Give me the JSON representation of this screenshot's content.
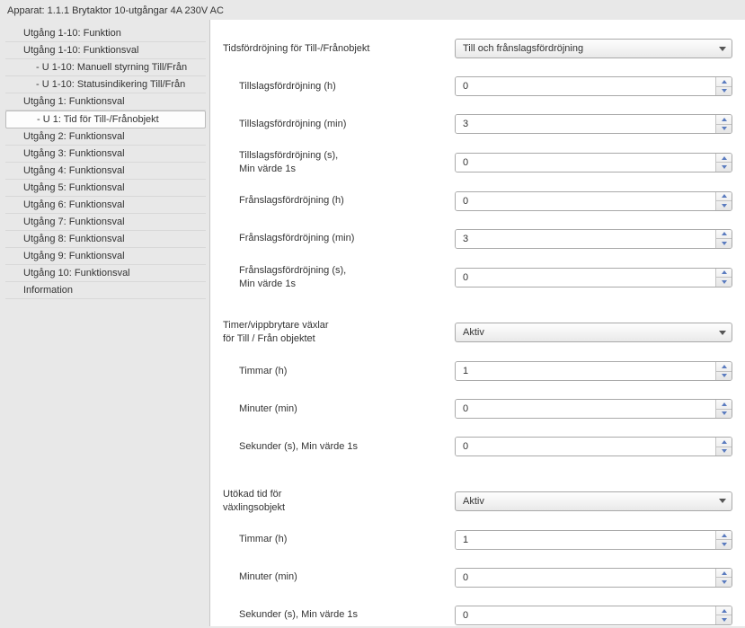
{
  "header": "Apparat: 1.1.1  Brytaktor 10-utgångar 4A 230V AC",
  "sidebar": {
    "items": [
      {
        "label": "Utgång 1-10: Funktion",
        "indent": 0,
        "selected": false
      },
      {
        "label": "Utgång 1-10: Funktionsval",
        "indent": 0,
        "selected": false
      },
      {
        "label": "- U 1-10: Manuell styrning Till/Från",
        "indent": 1,
        "selected": false
      },
      {
        "label": "- U 1-10: Statusindikering Till/Från",
        "indent": 1,
        "selected": false
      },
      {
        "label": "Utgång 1: Funktionsval",
        "indent": 0,
        "selected": false
      },
      {
        "label": "- U 1: Tid för Till-/Frånobjekt",
        "indent": 1,
        "selected": true
      },
      {
        "label": "Utgång 2: Funktionsval",
        "indent": 0,
        "selected": false
      },
      {
        "label": "Utgång 3: Funktionsval",
        "indent": 0,
        "selected": false
      },
      {
        "label": "Utgång 4: Funktionsval",
        "indent": 0,
        "selected": false
      },
      {
        "label": "Utgång 5: Funktionsval",
        "indent": 0,
        "selected": false
      },
      {
        "label": "Utgång 6: Funktionsval",
        "indent": 0,
        "selected": false
      },
      {
        "label": "Utgång 7: Funktionsval",
        "indent": 0,
        "selected": false
      },
      {
        "label": "Utgång 8: Funktionsval",
        "indent": 0,
        "selected": false
      },
      {
        "label": "Utgång 9: Funktionsval",
        "indent": 0,
        "selected": false
      },
      {
        "label": "Utgång 10: Funktionsval",
        "indent": 0,
        "selected": false
      },
      {
        "label": "Information",
        "indent": 0,
        "selected": false
      }
    ]
  },
  "form": {
    "delayHeader": {
      "label": "Tidsfördröjning för Till-/Frånobjekt",
      "value": "Till och frånslagsfördröjning"
    },
    "onDelayH": {
      "label": "Tillslagsfördröjning (h)",
      "value": "0"
    },
    "onDelayMin": {
      "label": "Tillslagsfördröjning (min)",
      "value": "3"
    },
    "onDelayS": {
      "label": "Tillslagsfördröjning (s),\nMin värde 1s",
      "value": "0"
    },
    "offDelayH": {
      "label": "Frånslagsfördröjning (h)",
      "value": "0"
    },
    "offDelayMin": {
      "label": "Frånslagsfördröjning (min)",
      "value": "3"
    },
    "offDelayS": {
      "label": "Frånslagsfördröjning (s),\nMin värde 1s",
      "value": "0"
    },
    "timerHeader": {
      "label": "Timer/vippbrytare växlar\nför Till / Från objektet",
      "value": "Aktiv"
    },
    "timerH": {
      "label": "Timmar (h)",
      "value": "1"
    },
    "timerMin": {
      "label": "Minuter (min)",
      "value": "0"
    },
    "timerS": {
      "label": "Sekunder (s), Min värde 1s",
      "value": "0"
    },
    "extHeader": {
      "label": "Utökad tid för\nväxlingsobjekt",
      "value": "Aktiv"
    },
    "extH": {
      "label": "Timmar (h)",
      "value": "1"
    },
    "extMin": {
      "label": "Minuter (min)",
      "value": "0"
    },
    "extS": {
      "label": "Sekunder (s), Min värde 1s",
      "value": "0"
    }
  }
}
